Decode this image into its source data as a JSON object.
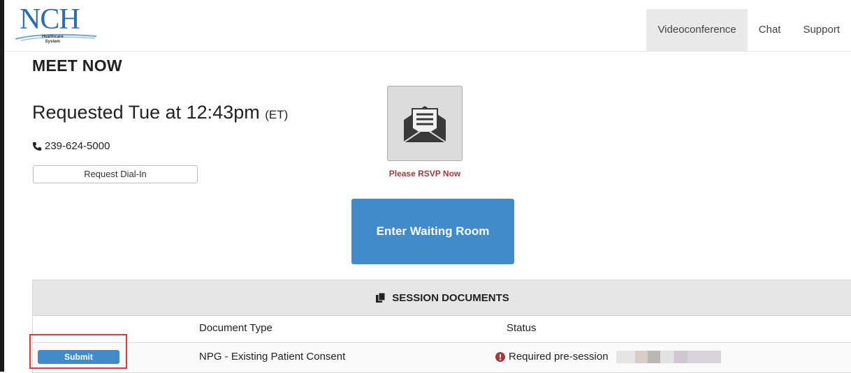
{
  "header": {
    "logo_text": "NCH",
    "logo_sub_line1": "Healthcare",
    "logo_sub_line2": "System",
    "nav": [
      {
        "label": "Videoconference",
        "active": true
      },
      {
        "label": "Chat",
        "active": false
      },
      {
        "label": "Support",
        "active": false
      }
    ]
  },
  "main": {
    "page_title": "MEET NOW",
    "requested_text": "Requested Tue at 12:43pm",
    "timezone": "(ET)",
    "phone": "239-624-5000",
    "dialin_button": "Request Dial-In",
    "rsvp_label": "Please RSVP Now",
    "enter_button": "Enter Waiting Room"
  },
  "documents": {
    "title": "SESSION DOCUMENTS",
    "columns": [
      "Document Type",
      "Status"
    ],
    "rows": [
      {
        "action": "Submit",
        "type": "NPG - Existing Patient Consent",
        "status": "Required pre-session"
      }
    ]
  },
  "colors": {
    "primary": "#428bca",
    "rsvp": "#a23b3b",
    "highlight": "#e33333",
    "logo": "#2d6cb3"
  }
}
